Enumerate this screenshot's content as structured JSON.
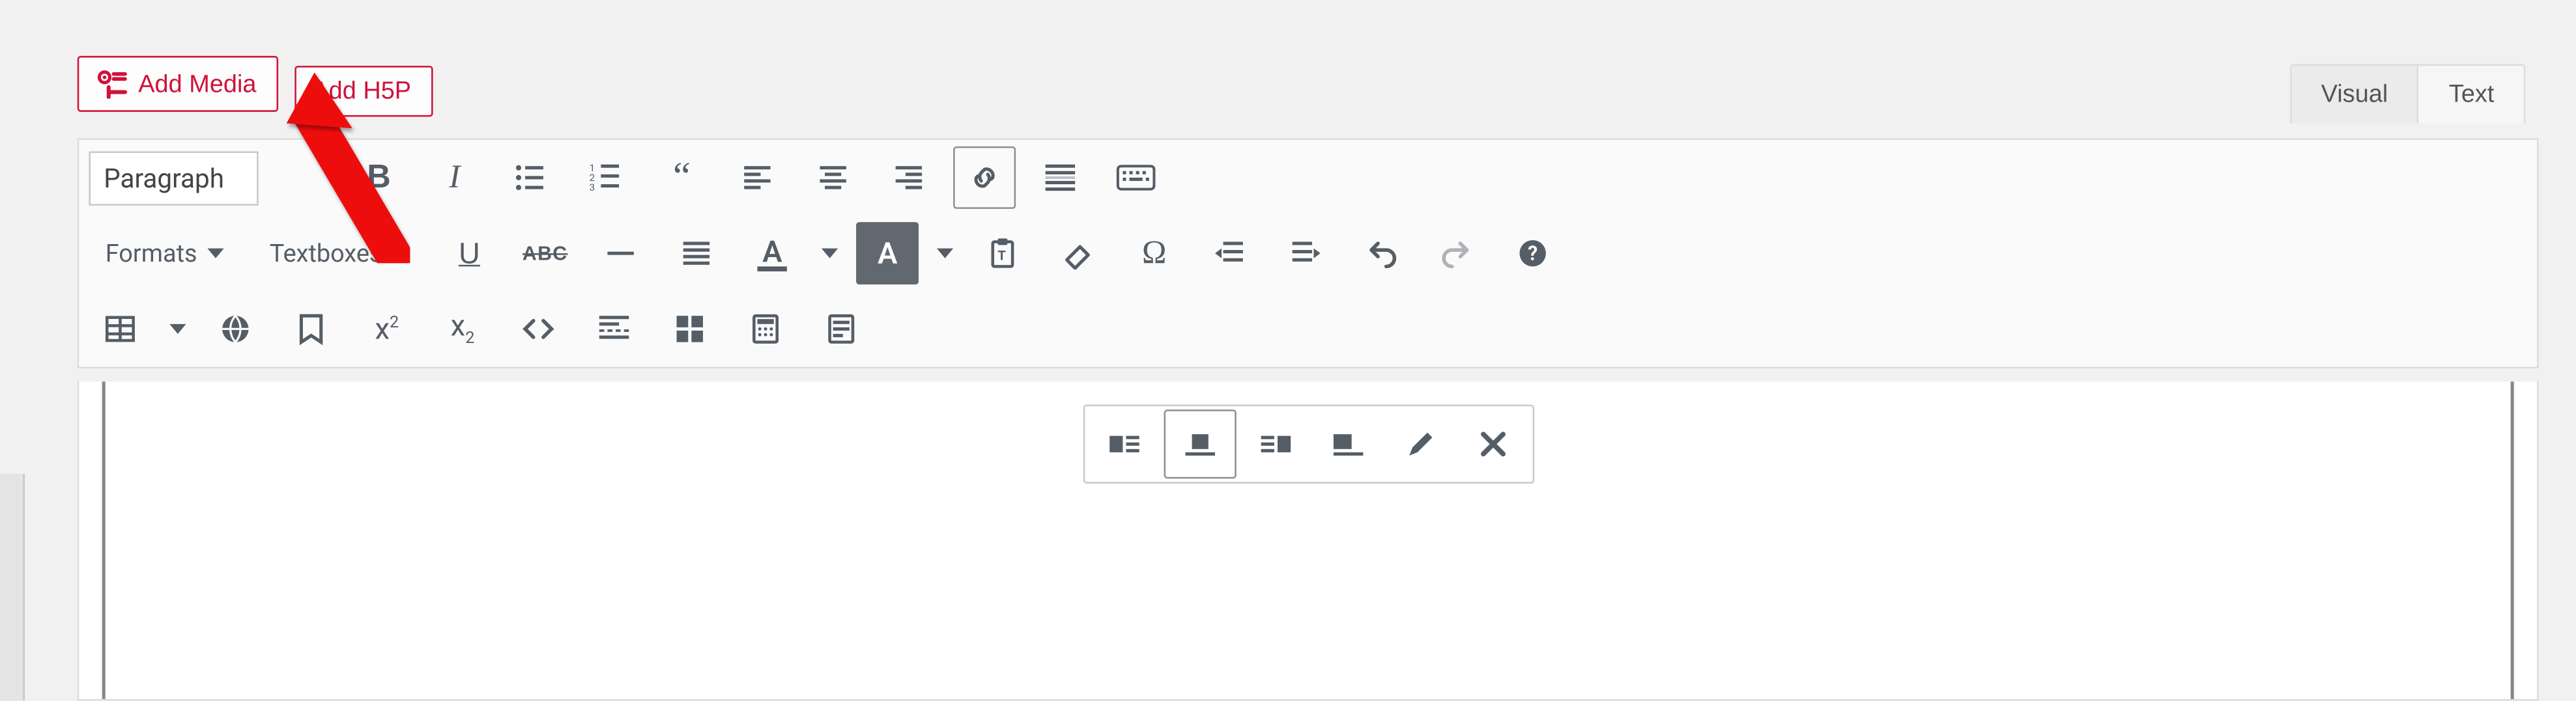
{
  "buttons": {
    "add_media": "Add Media",
    "add_h5p": "Add H5P"
  },
  "tabs": {
    "visual": "Visual",
    "text": "Text",
    "active": "Visual"
  },
  "toolbar": {
    "paragraph_selector": "Paragraph",
    "formats_label": "Formats",
    "textboxes_label": "Textboxes",
    "row1": [
      {
        "name": "bold",
        "glyph": "B"
      },
      {
        "name": "italic",
        "glyph": "I"
      },
      {
        "name": "bullet-list"
      },
      {
        "name": "numbered-list"
      },
      {
        "name": "blockquote"
      },
      {
        "name": "align-left"
      },
      {
        "name": "align-center"
      },
      {
        "name": "align-right"
      },
      {
        "name": "link",
        "boxed": true
      },
      {
        "name": "read-more"
      },
      {
        "name": "toolbar-toggle"
      }
    ],
    "row2": [
      {
        "name": "underline",
        "glyph": "U"
      },
      {
        "name": "strikethrough",
        "glyph": "ABC"
      },
      {
        "name": "horizontal-rule"
      },
      {
        "name": "justify"
      },
      {
        "name": "text-color",
        "glyph": "A"
      },
      {
        "name": "text-color-picker"
      },
      {
        "name": "background-color",
        "glyph": "A",
        "hilite": true
      },
      {
        "name": "background-color-picker"
      },
      {
        "name": "paste-text"
      },
      {
        "name": "clear-formatting"
      },
      {
        "name": "special-character"
      },
      {
        "name": "decrease-indent"
      },
      {
        "name": "increase-indent"
      },
      {
        "name": "undo"
      },
      {
        "name": "redo"
      },
      {
        "name": "help"
      }
    ],
    "row3": [
      {
        "name": "table"
      },
      {
        "name": "table-picker"
      },
      {
        "name": "emoticons"
      },
      {
        "name": "bookmark"
      },
      {
        "name": "superscript"
      },
      {
        "name": "subscript"
      },
      {
        "name": "code"
      },
      {
        "name": "page-break"
      },
      {
        "name": "layout-grid"
      },
      {
        "name": "calculator"
      },
      {
        "name": "paste-word"
      }
    ]
  },
  "inline_toolbar": [
    {
      "name": "image-align-left"
    },
    {
      "name": "image-align-center",
      "boxed": true
    },
    {
      "name": "image-align-right"
    },
    {
      "name": "image-align-none"
    },
    {
      "name": "edit-image"
    },
    {
      "name": "remove-image"
    }
  ],
  "colors": {
    "accent": "#d0113a",
    "icon": "#555d66",
    "page_bg": "#f1f1f1"
  }
}
